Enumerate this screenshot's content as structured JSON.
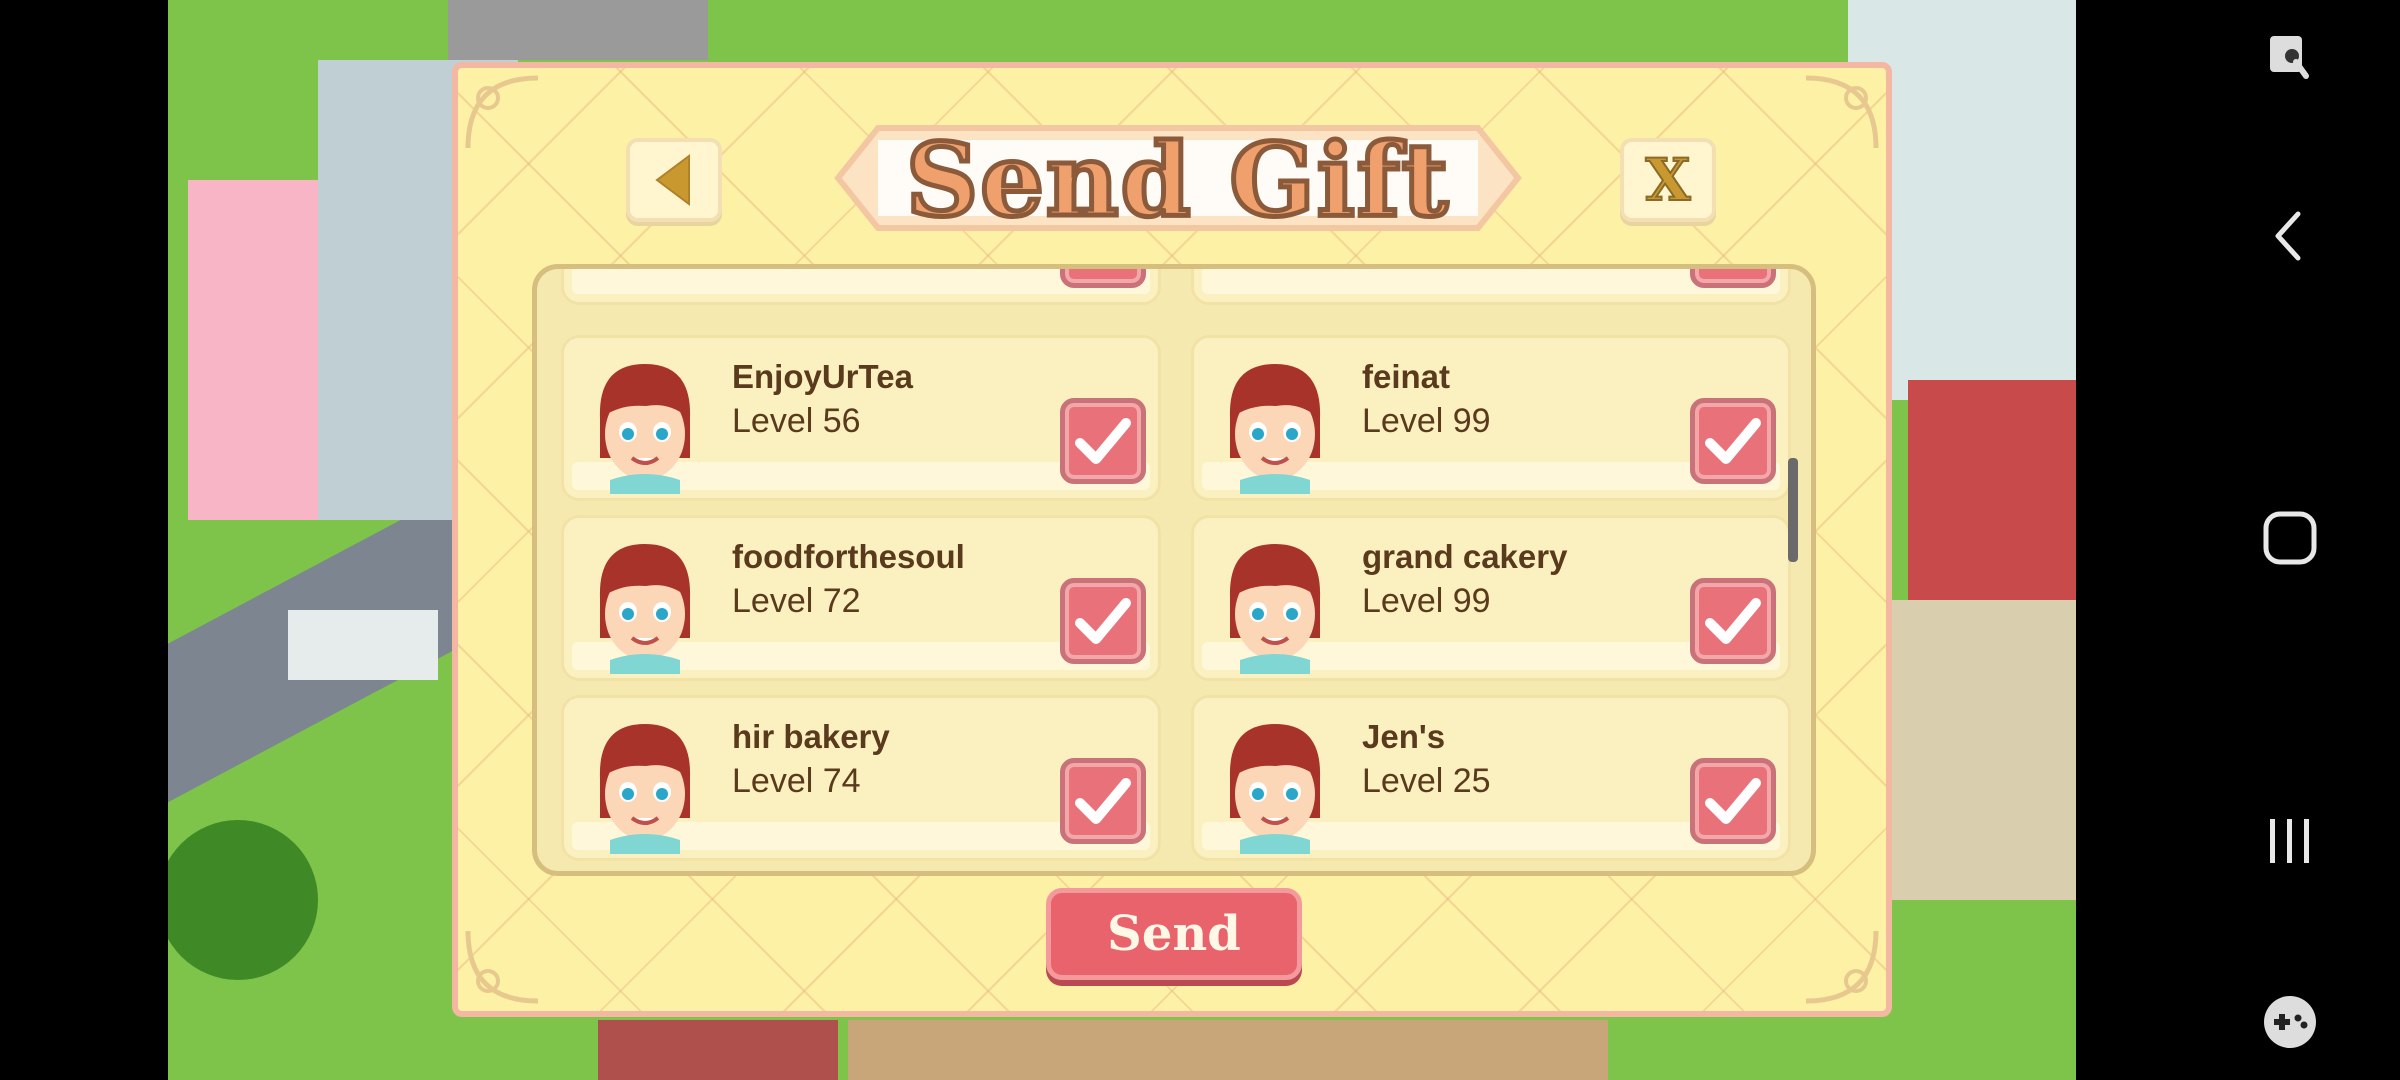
{
  "dialog": {
    "title": "Send Gift",
    "back_icon": "triangle-left-icon",
    "close_label": "X",
    "send_label": "Send"
  },
  "friends": [
    {
      "name": "EnjoyUrTea",
      "level": "Level 56",
      "checked": true
    },
    {
      "name": "feinat",
      "level": "Level 99",
      "checked": true
    },
    {
      "name": "foodforthesoul",
      "level": "Level 72",
      "checked": true
    },
    {
      "name": "grand cakery",
      "level": "Level 99",
      "checked": true
    },
    {
      "name": "hir bakery",
      "level": "Level 74",
      "checked": true
    },
    {
      "name": "Jen's",
      "level": "Level 25",
      "checked": true
    }
  ],
  "colors": {
    "dialog_bg": "#fdf1a6",
    "title_fill": "#f0a06c",
    "checkbox": "#e9727a",
    "send_button": "#e8636b"
  },
  "nav": {
    "icons": [
      "screenshot-edit-icon",
      "back-icon",
      "home-icon",
      "recents-icon",
      "game-tools-icon"
    ]
  }
}
